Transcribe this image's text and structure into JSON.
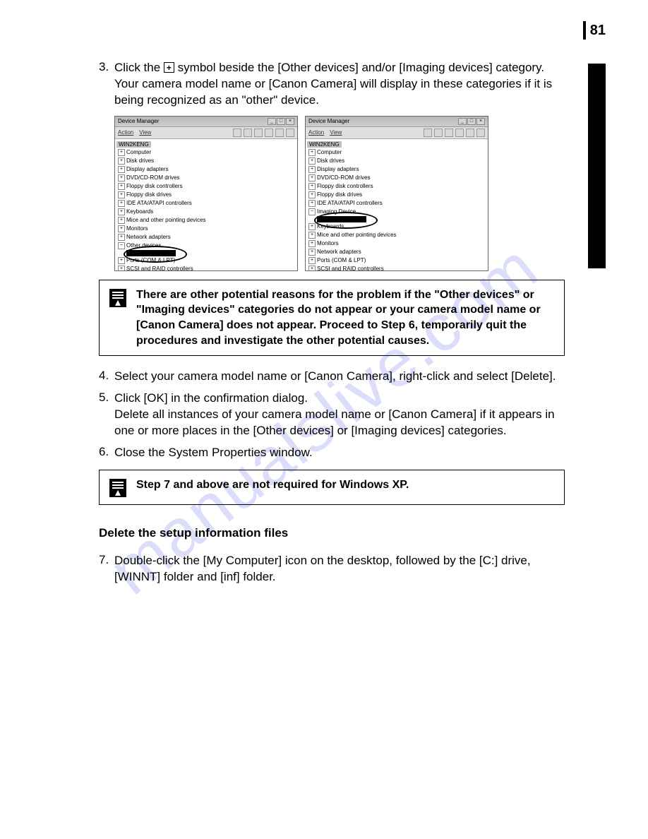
{
  "page_number": "81",
  "watermark": "manualslive.com",
  "steps": {
    "s3": {
      "num": "3.",
      "text_before_icon": "Click the ",
      "text_after_icon": " symbol beside the [Other devices] and/or [Imaging devices] category. Your camera model name or [Canon Camera] will display in these categories if it is being recognized as an \"other\" device."
    },
    "s4": {
      "num": "4.",
      "text": "Select your camera model name or [Canon Camera], right-click and select [Delete]."
    },
    "s5": {
      "num": "5.",
      "text": "Click [OK] in the confirmation dialog.\nDelete all instances of your camera model name or [Canon Camera] if it appears in one or more places in the [Other devices] or [Imaging devices] categories."
    },
    "s6": {
      "num": "6.",
      "text": "Close the System Properties window."
    },
    "s7": {
      "num": "7.",
      "text": "Double-click the [My Computer] icon on the desktop, followed by the [C:] drive, [WINNT] folder and [inf] folder."
    }
  },
  "notes": {
    "n1": "There are other potential reasons for the problem if the \"Other devices\" or \"Imaging devices\" categories do not appear or your camera model name or [Canon Camera] does not appear. Proceed to Step 6, temporarily quit the procedures and investigate the other potential causes.",
    "n2": "Step 7 and above are not required for Windows XP."
  },
  "heading": "Delete the setup information files",
  "devmgr": {
    "title": "Device Manager",
    "menu_action": "Action",
    "menu_view": "View",
    "root": "WIN2KENG",
    "nodes_left": [
      "Computer",
      "Disk drives",
      "Display adapters",
      "DVD/CD-ROM drives",
      "Floppy disk controllers",
      "Floppy disk drives",
      "IDE ATA/ATAPI controllers",
      "Keyboards",
      "Mice and other pointing devices",
      "Monitors",
      "Network adapters"
    ],
    "other_devices": "Other devices",
    "ports": "Ports (COM & LPT)",
    "scsi": "SCSI and RAID controllers",
    "nodes_right": [
      "Computer",
      "Disk drives",
      "Display adapters",
      "DVD/CD-ROM drives",
      "Floppy disk controllers",
      "Floppy disk drives",
      "IDE ATA/ATAPI controllers"
    ],
    "imaging_device": "Imaging Device",
    "keyboards": "Keyboards",
    "mice": "Mice and other pointing devices",
    "monitors": "Monitors",
    "network": "Network adapters",
    "ports2": "Ports (COM & LPT)",
    "scsi2": "SCSI and RAID controllers"
  }
}
